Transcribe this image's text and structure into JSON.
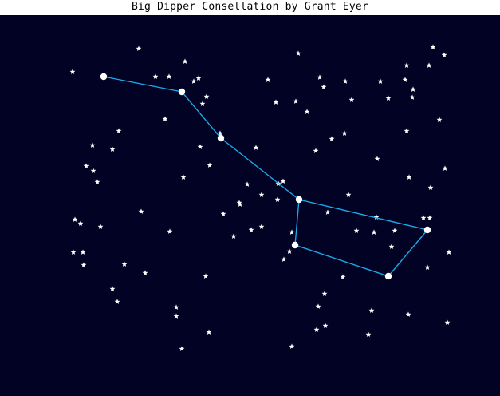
{
  "window": {
    "title": "Big Dipper Consellation by Grant Eyer"
  },
  "colors": {
    "sky": "#020324",
    "line": "#1aa8e8",
    "star": "#ffffff"
  },
  "scene": {
    "background_stars_count_visible": 120,
    "constellation_nodes": 8
  }
}
